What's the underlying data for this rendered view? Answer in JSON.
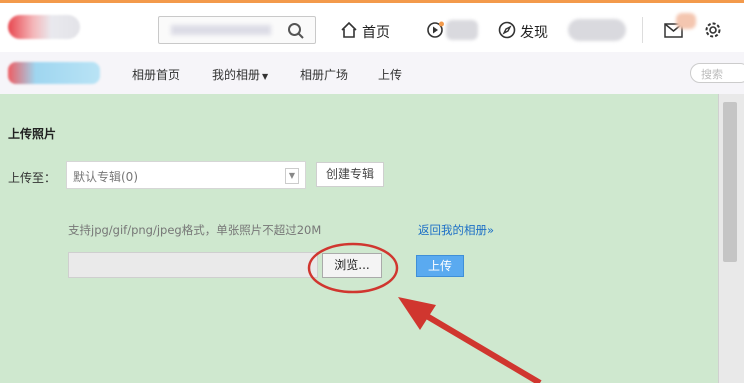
{
  "topbar": {
    "nav": [
      {
        "label": "首页",
        "icon": "home-icon"
      },
      {
        "label": "发现",
        "icon": "compass-icon"
      }
    ],
    "icons": [
      "search-icon",
      "play-icon",
      "mail-icon",
      "gear-icon"
    ]
  },
  "subnav": {
    "items": [
      "相册首页",
      "我的相册",
      "相册广场",
      "上传"
    ],
    "search_placeholder": "搜索"
  },
  "upload": {
    "title": "上传照片",
    "upload_to_label": "上传至：",
    "album_select": "默认专辑(0)",
    "create_album_button": "创建专辑",
    "hint": "支持jpg/gif/png/jpeg格式，单张照片不超过20M",
    "back_link": "返回我的相册»",
    "browse_button": "浏览...",
    "upload_button": "上传"
  },
  "colors": {
    "accent_top": "#f39a4b",
    "page_bg": "#cfe8cf",
    "link": "#1d6fc6",
    "primary_button": "#5aaaf0",
    "annotation": "#d0362f"
  }
}
